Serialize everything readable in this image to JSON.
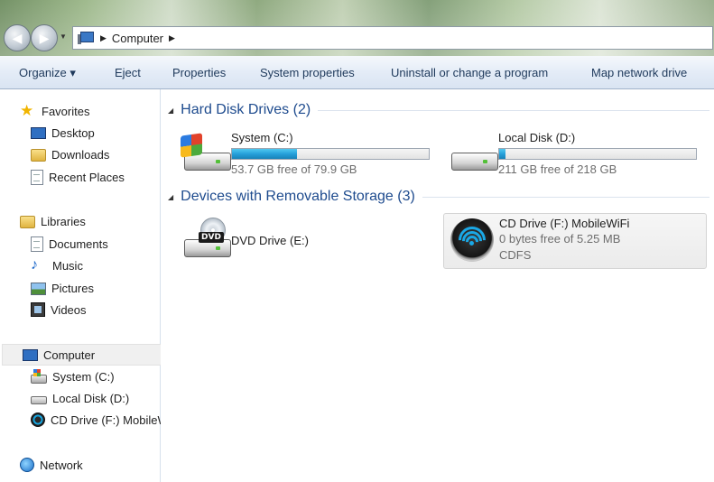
{
  "address": {
    "crumbs": [
      "Computer"
    ]
  },
  "toolbar": {
    "organize": "Organize ▾",
    "eject": "Eject",
    "properties": "Properties",
    "system_properties": "System properties",
    "uninstall": "Uninstall or change a program",
    "map_drive": "Map network drive"
  },
  "sidebar": {
    "favorites": "Favorites",
    "desktop": "Desktop",
    "downloads": "Downloads",
    "recent": "Recent Places",
    "libraries": "Libraries",
    "documents": "Documents",
    "music": "Music",
    "pictures": "Pictures",
    "videos": "Videos",
    "computer": "Computer",
    "system_c": "System (C:)",
    "local_d": "Local Disk (D:)",
    "cd_f": "CD Drive (F:) MobileWiFi",
    "network": "Network"
  },
  "sections": {
    "hdd": "Hard Disk Drives (2)",
    "removable": "Devices with Removable Storage (3)"
  },
  "drives": {
    "c": {
      "name": "System (C:)",
      "free": "53.7 GB free of 79.9 GB",
      "used_fraction": 0.33
    },
    "d": {
      "name": "Local Disk (D:)",
      "free": "211 GB free of 218 GB",
      "used_fraction": 0.03
    },
    "e": {
      "name": "DVD Drive (E:)",
      "label": "DVD"
    },
    "f": {
      "name": "CD Drive (F:) MobileWiFi",
      "free": "0 bytes free of 5.25 MB",
      "fs": "CDFS"
    }
  },
  "colors": {
    "accent": "#1e4b8e",
    "bar": "#26a0da"
  }
}
